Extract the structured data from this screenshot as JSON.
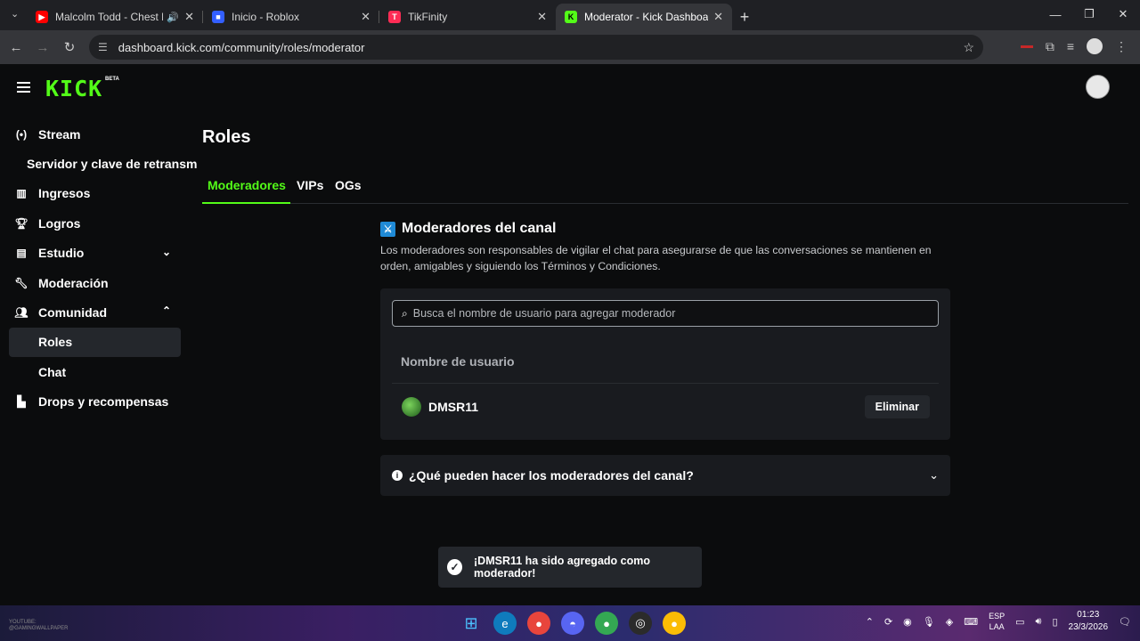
{
  "browser": {
    "tabs": [
      {
        "title": "Malcolm Todd - Chest Pain",
        "favicon": "youtube-icon",
        "color": "#ff0000",
        "audio": true
      },
      {
        "title": "Inicio - Roblox",
        "favicon": "roblox-icon",
        "color": "#335fff"
      },
      {
        "title": "TikFinity",
        "favicon": "tikfinity-icon",
        "color": "#fe2c55"
      },
      {
        "title": "Moderator - Kick Dashboard",
        "favicon": "kick-icon",
        "color": "#53fc18",
        "active": true
      }
    ],
    "url": "dashboard.kick.com/community/roles/moderator"
  },
  "header": {
    "logo": "KICK",
    "beta": "BETA"
  },
  "sidebar": {
    "items": [
      {
        "label": "Stream",
        "icon": "broadcast-icon"
      },
      {
        "label": "Servidor y clave de retransm",
        "icon": ""
      },
      {
        "label": "Ingresos",
        "icon": "chart-icon"
      },
      {
        "label": "Logros",
        "icon": "trophy-icon"
      },
      {
        "label": "Estudio",
        "icon": "studio-icon",
        "chevron": "down"
      },
      {
        "label": "Moderación",
        "icon": "wrench-icon"
      },
      {
        "label": "Comunidad",
        "icon": "people-icon",
        "chevron": "up"
      },
      {
        "label": "Roles",
        "icon": "",
        "active": true
      },
      {
        "label": "Chat",
        "icon": ""
      },
      {
        "label": "Drops y recompensas",
        "icon": "gift-icon"
      }
    ]
  },
  "main": {
    "title": "Roles",
    "tabs": [
      {
        "label": "Moderadores",
        "active": true
      },
      {
        "label": "VIPs"
      },
      {
        "label": "OGs"
      }
    ],
    "section": {
      "title": "Moderadores del canal",
      "description": "Los moderadores son responsables de vigilar el chat para asegurarse de que las conversaciones se mantienen en orden, amigables y siguiendo los Términos y Condiciones."
    },
    "search": {
      "placeholder": "Busca el nombre de usuario para agregar moderador",
      "value": ""
    },
    "table": {
      "column": "Nombre de usuario",
      "rows": [
        {
          "username": "DMSR11",
          "action": "Eliminar"
        }
      ]
    },
    "faq": "¿Qué pueden hacer los moderadores del canal?"
  },
  "toast": {
    "message": "¡DMSR11 ha sido agregado como moderador!"
  },
  "taskbar": {
    "language": "ESP",
    "layout": "LAA",
    "time": "01:23",
    "date": "23/3/2026",
    "watermark_line1": "YOUTUBE:",
    "watermark_line2": "@GAMINGWALLPAPER"
  },
  "colors": {
    "accent": "#53fc18",
    "background": "#0b0c0d",
    "card": "#191b1f"
  }
}
